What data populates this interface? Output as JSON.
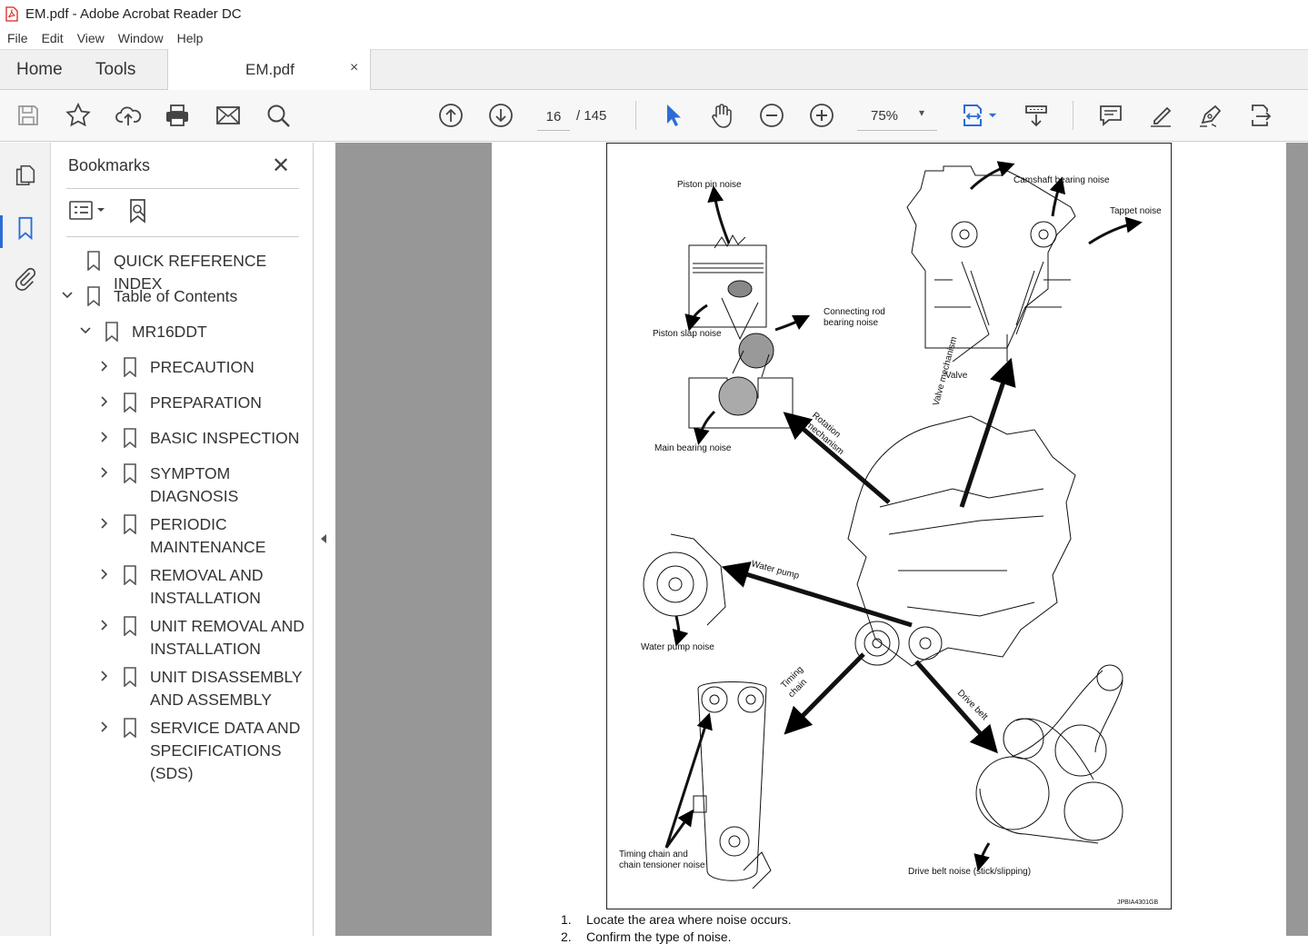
{
  "window": {
    "title": "EM.pdf - Adobe Acrobat Reader DC",
    "menu": [
      "File",
      "Edit",
      "View",
      "Window",
      "Help"
    ]
  },
  "tabs": {
    "home": "Home",
    "tools": "Tools",
    "document": "EM.pdf",
    "close": "×"
  },
  "toolbar": {
    "current_page": "16",
    "page_sep": "/  145",
    "zoom": "75%",
    "zoom_arrow": "▾"
  },
  "bookmarks": {
    "title": "Bookmarks",
    "close": "✕",
    "items": [
      {
        "label": "QUICK REFERENCE INDEX",
        "chev": ""
      },
      {
        "label": "Table of Contents",
        "chev": "∨"
      },
      {
        "label": "MR16DDT",
        "chev": "∨"
      },
      {
        "label": "PRECAUTION",
        "chev": "›"
      },
      {
        "label": "PREPARATION",
        "chev": "›"
      },
      {
        "label": "BASIC INSPECTION",
        "chev": "›"
      },
      {
        "label": "SYMPTOM DIAGNOSIS",
        "chev": "›"
      },
      {
        "label": "PERIODIC MAINTENANCE",
        "chev": "›"
      },
      {
        "label": "REMOVAL AND INSTALLATION",
        "chev": "›"
      },
      {
        "label": "UNIT REMOVAL AND INSTALLATION",
        "chev": "›"
      },
      {
        "label": "UNIT DISASSEMBLY AND ASSEMBLY",
        "chev": "›"
      },
      {
        "label": "SERVICE DATA AND SPECIFICATIONS (SDS)",
        "chev": "›"
      }
    ]
  },
  "figure": {
    "labels": {
      "piston_pin": "Piston pin noise",
      "camshaft": "Camshaft bearing noise",
      "tappet": "Tappet noise",
      "conrod": "Connecting rod",
      "conrod2": "bearing noise",
      "piston_slap": "Piston slap noise",
      "valve": "Valve",
      "valve_mech": "Valve mechanism",
      "rotation": "Rotation",
      "rotation2": "mechanism",
      "main_bearing": "Main bearing noise",
      "water_pump": "Water pump",
      "water_pump_noise": "Water pump noise",
      "timing": "Timing",
      "timing2": "chain",
      "drive_belt": "Drive belt",
      "tc_noise": "Timing chain and",
      "tc_noise2": "chain tensioner noise",
      "belt_noise": "Drive belt noise (stick/slipping)",
      "code": "JPBIA4301GB"
    }
  },
  "steps": [
    {
      "n": "1.",
      "text": "Locate the area where noise occurs."
    },
    {
      "n": "2.",
      "text": "Confirm the type of noise."
    }
  ],
  "colors": {
    "accent": "#2d6cd6",
    "doc_bg": "#979797",
    "pdf_red": "#d9251c"
  }
}
